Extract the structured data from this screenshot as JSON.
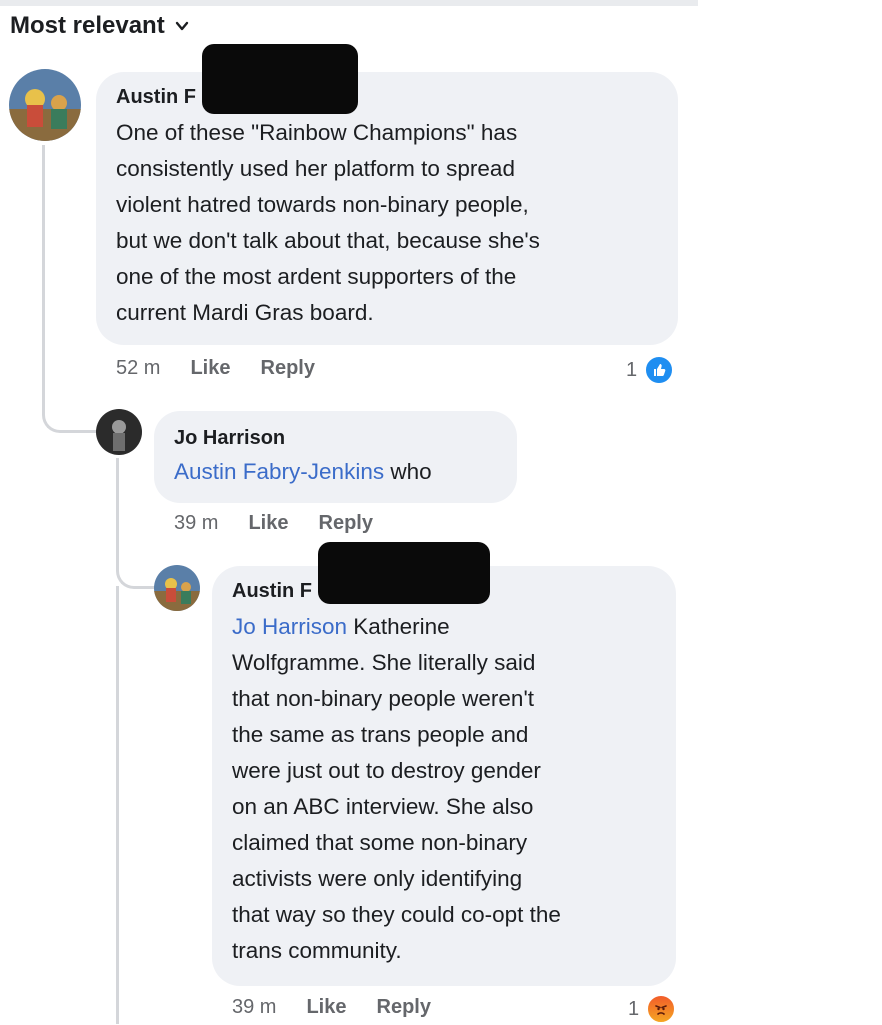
{
  "sort": {
    "label": "Most relevant"
  },
  "comments": [
    {
      "author": "Austin F",
      "mention": "",
      "text": "One of these \"Rainbow Champions\" has\nconsistently used her platform to spread\nviolent hatred towards non-binary people,\nbut we don't talk about that, because she's\none of the most ardent supporters of the\ncurrent Mardi Gras board.",
      "time": "52 m",
      "like_label": "Like",
      "reply_label": "Reply",
      "reaction_count": "1",
      "reaction_icon": "like-icon"
    },
    {
      "author": "Jo Harrison",
      "mention": "Austin Fabry-Jenkins",
      "text": " who",
      "time": "39 m",
      "like_label": "Like",
      "reply_label": "Reply"
    },
    {
      "author": "Austin F",
      "mention": "Jo Harrison",
      "text": " Katherine\nWolfgramme. She literally said\nthat non-binary people weren't\nthe same as trans people and\nwere just out to destroy gender\non an ABC interview. She also\nclaimed that some non-binary\nactivists were only identifying\nthat way so they could co-opt the\ntrans community.",
      "time": "39 m",
      "like_label": "Like",
      "reply_label": "Reply",
      "reaction_count": "1",
      "reaction_icon": "angry-icon"
    }
  ],
  "colors": {
    "bubble": "#eff1f5",
    "mention": "#3b6cc9",
    "like": "#1f8ef1",
    "angry": "#f25c2a",
    "meta_text": "#65676b"
  }
}
